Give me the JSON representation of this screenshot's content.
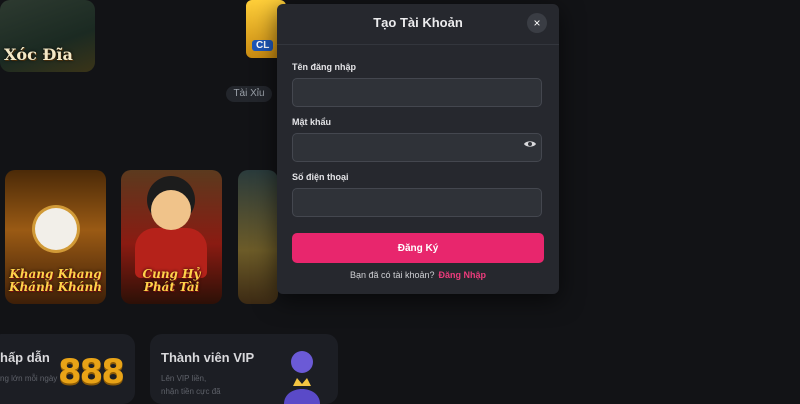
{
  "background": {
    "top_game": {
      "title": "Xóc Đĩa",
      "subtitle": "Xóc Đĩa"
    },
    "club_badge": "CL",
    "chip": "Tài Xỉu",
    "cards": [
      {
        "title_line1": "Khang Khang",
        "title_line2": "Khánh Khánh"
      },
      {
        "title_line1": "Cung Hỷ",
        "title_line2": "Phát Tài"
      },
      {
        "title_line1": "",
        "title_line2": ""
      }
    ],
    "promos": [
      {
        "title": "hấp dẫn",
        "sub_line1": "ng lớn mỗi ngày",
        "sub_line2": "",
        "badge": "888"
      },
      {
        "title": "Thành viên VIP",
        "sub_line1": "Lên VIP liền,",
        "sub_line2": "nhận tiền cực đã"
      }
    ]
  },
  "modal": {
    "title": "Tạo Tài Khoản",
    "close_label": "×",
    "fields": {
      "username": {
        "label": "Tên đăng nhập",
        "value": "",
        "placeholder": ""
      },
      "password": {
        "label": "Mật khẩu",
        "value": "",
        "placeholder": ""
      },
      "phone": {
        "label": "Số điện thoại",
        "value": "",
        "placeholder": ""
      }
    },
    "submit_label": "Đăng Ký",
    "footer_text": "Bạn đã có tài khoản?",
    "login_link": "Đăng Nhập"
  },
  "colors": {
    "accent": "#e8266d",
    "link": "#ec3b7c",
    "modal_bg": "#26282e",
    "page_bg": "#121316"
  },
  "icons": {
    "close": "close-icon",
    "show_password": "eye-icon",
    "vip": "crown-icon"
  }
}
